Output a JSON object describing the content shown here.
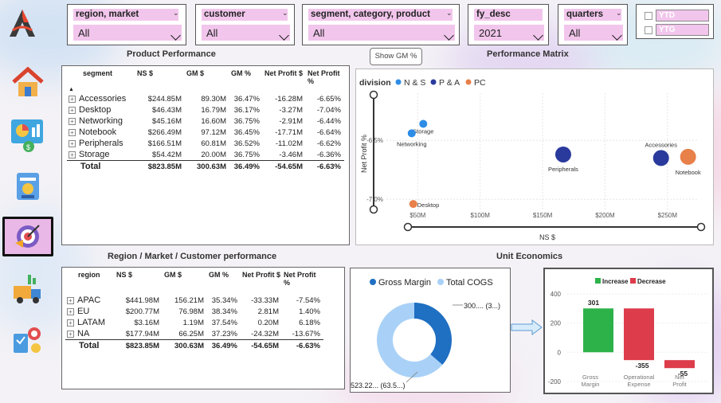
{
  "colors": {
    "accent_pink": "#f2c6ec",
    "ns_blue": "#2d8de6",
    "pa_navy": "#2a3a9c",
    "pc_orange": "#e8804a",
    "gross_margin": "#1f6fc2",
    "total_cogs": "#a9d1f7",
    "increase": "#2db24a",
    "decrease": "#dd3c4b"
  },
  "sidebar": {
    "items": [
      {
        "icon": "home-icon"
      },
      {
        "icon": "finance-dashboard-icon"
      },
      {
        "icon": "sales-analysis-icon"
      },
      {
        "icon": "marketing-target-icon"
      },
      {
        "icon": "supply-chain-icon"
      },
      {
        "icon": "executive-icon"
      }
    ]
  },
  "slicers": {
    "region_market": {
      "label": "region, market",
      "value": "All"
    },
    "customer": {
      "label": "customer",
      "value": "All"
    },
    "segment_category_product": {
      "label": "segment, category, product",
      "value": "All"
    },
    "fy_desc": {
      "label": "fy_desc",
      "value": "2021"
    },
    "quarters": {
      "label": "quarters",
      "value": "All"
    },
    "ytd": "YTD",
    "ytg": "YTG"
  },
  "product_performance": {
    "title": "Product Performance",
    "headers": [
      "segment",
      "NS $",
      "GM $",
      "GM %",
      "Net Profit $",
      "Net Profit %"
    ],
    "rows": [
      {
        "label": "Accessories",
        "ns": "$244.85M",
        "gm": "89.30M",
        "gmp": "36.47%",
        "np": "-16.28M",
        "npp": "-6.65%"
      },
      {
        "label": "Desktop",
        "ns": "$46.43M",
        "gm": "16.79M",
        "gmp": "36.17%",
        "np": "-3.27M",
        "npp": "-7.04%"
      },
      {
        "label": "Networking",
        "ns": "$45.16M",
        "gm": "16.60M",
        "gmp": "36.75%",
        "np": "-2.91M",
        "npp": "-6.44%"
      },
      {
        "label": "Notebook",
        "ns": "$266.49M",
        "gm": "97.12M",
        "gmp": "36.45%",
        "np": "-17.71M",
        "npp": "-6.64%"
      },
      {
        "label": "Peripherals",
        "ns": "$166.51M",
        "gm": "60.81M",
        "gmp": "36.52%",
        "np": "-11.02M",
        "npp": "-6.62%"
      },
      {
        "label": "Storage",
        "ns": "$54.42M",
        "gm": "20.00M",
        "gmp": "36.75%",
        "np": "-3.46M",
        "npp": "-6.36%"
      }
    ],
    "total": {
      "label": "Total",
      "ns": "$823.85M",
      "gm": "300.63M",
      "gmp": "36.49%",
      "np": "-54.65M",
      "npp": "-6.63%"
    }
  },
  "show_gm_button": "Show GM %",
  "performance_matrix": {
    "title": "Performance Matrix",
    "legend_title": "division",
    "legend": [
      "N & S",
      "P & A",
      "PC"
    ],
    "ylabel": "Net Profit %",
    "xlabel": "NS $",
    "yticks": [
      "-6.5%",
      "-7.0%"
    ],
    "xticks": [
      "$50M",
      "$100M",
      "$150M",
      "$200M",
      "$250M"
    ]
  },
  "region_performance": {
    "title": "Region / Market / Customer performance",
    "headers": [
      "region",
      "NS $",
      "GM $",
      "GM %",
      "Net Profit $",
      "Net Profit %"
    ],
    "rows": [
      {
        "label": "APAC",
        "ns": "$441.98M",
        "gm": "156.21M",
        "gmp": "35.34%",
        "np": "-33.33M",
        "npp": "-7.54%"
      },
      {
        "label": "EU",
        "ns": "$200.77M",
        "gm": "76.98M",
        "gmp": "38.34%",
        "np": "2.81M",
        "npp": "1.40%"
      },
      {
        "label": "LATAM",
        "ns": "$3.16M",
        "gm": "1.19M",
        "gmp": "37.54%",
        "np": "0.20M",
        "npp": "6.18%"
      },
      {
        "label": "NA",
        "ns": "$177.94M",
        "gm": "66.25M",
        "gmp": "37.23%",
        "np": "-24.32M",
        "npp": "-13.67%"
      }
    ],
    "total": {
      "label": "Total",
      "ns": "$823.85M",
      "gm": "300.63M",
      "gmp": "36.49%",
      "np": "-54.65M",
      "npp": "-6.63%"
    }
  },
  "unit_economics": {
    "title": "Unit Economics",
    "donut_legend": [
      "Gross Margin",
      "Total COGS"
    ],
    "donut_labels": [
      "300.... (3...)",
      "523.22... (63.5...)"
    ],
    "waterfall_legend": [
      "Increase",
      "Decrease"
    ]
  },
  "chart_data": [
    {
      "type": "scatter",
      "title": "Performance Matrix",
      "xlabel": "NS $",
      "ylabel": "Net Profit %",
      "xlim": [
        30,
        275
      ],
      "ylim": [
        -7.1,
        -6.1
      ],
      "points": [
        {
          "label": "Storage",
          "x": 54.42,
          "y": -6.36,
          "series": "N & S"
        },
        {
          "label": "Networking",
          "x": 45.16,
          "y": -6.44,
          "series": "N & S"
        },
        {
          "label": "Peripherals",
          "x": 166.51,
          "y": -6.62,
          "series": "P & A"
        },
        {
          "label": "Accessories",
          "x": 244.85,
          "y": -6.65,
          "series": "P & A"
        },
        {
          "label": "Notebook",
          "x": 266.49,
          "y": -6.64,
          "series": "PC"
        },
        {
          "label": "Desktop",
          "x": 46.43,
          "y": -7.04,
          "series": "PC"
        }
      ]
    },
    {
      "type": "pie",
      "series": [
        {
          "name": "Gross Margin",
          "value": 300.63
        },
        {
          "name": "Total COGS",
          "value": 523.22
        }
      ]
    },
    {
      "type": "bar",
      "categories": [
        "Gross Margin",
        "Operational Expense",
        "Net Profit"
      ],
      "values": [
        301,
        -355,
        -55
      ],
      "ylim": [
        -250,
        450
      ],
      "yticks": [
        400,
        200,
        0,
        -200
      ]
    }
  ]
}
